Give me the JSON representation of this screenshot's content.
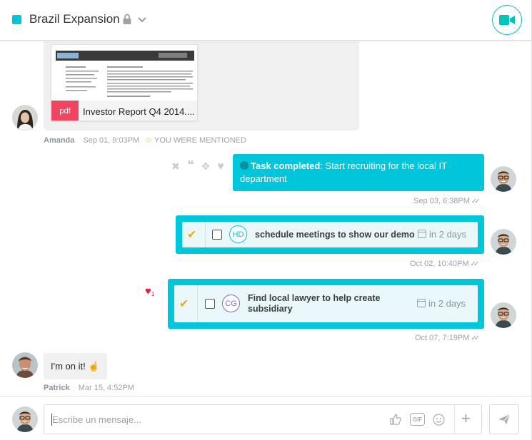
{
  "header": {
    "title": "Brazil Expansion",
    "accent_color": "#00c5d6",
    "lock_icon": "lock-icon",
    "chevron_icon": "chevron-down-icon",
    "video_icon": "video-camera-icon"
  },
  "messages": {
    "file": {
      "badge": "pdf",
      "name": "Investor Report Q4 2014....",
      "author": "Amanda",
      "time": "Sep 01, 9:03PM",
      "mention": "YOU WERE MENTIONED"
    },
    "task_completed": {
      "prefix": "Task completed",
      "text": ": Start recruiting for the local IT department",
      "time": "Sep 03, 6:38PM"
    },
    "task1": {
      "assignee": "HD",
      "text": "schedule meetings to show our demo",
      "due": "in 2 days",
      "time": "Oct 02, 10:40PM"
    },
    "task2": {
      "assignee": "CG",
      "text": "Find local lawyer to help create subsidiary",
      "due": "in 2 days",
      "time": "Oct 07, 7:19PM",
      "reaction_count": "1"
    },
    "plain": {
      "text": "I'm on it! ☝",
      "author": "Patrick",
      "time": "Mar 15, 4:52PM"
    }
  },
  "composer": {
    "placeholder": "Escribe un mensaje...",
    "gif_label": "GIF",
    "plus_label": "+"
  },
  "colors": {
    "cyan": "#00c6dc",
    "pdf_red": "#ef4560",
    "check_orange": "#f2a900",
    "heart_red": "#d91f3c"
  }
}
